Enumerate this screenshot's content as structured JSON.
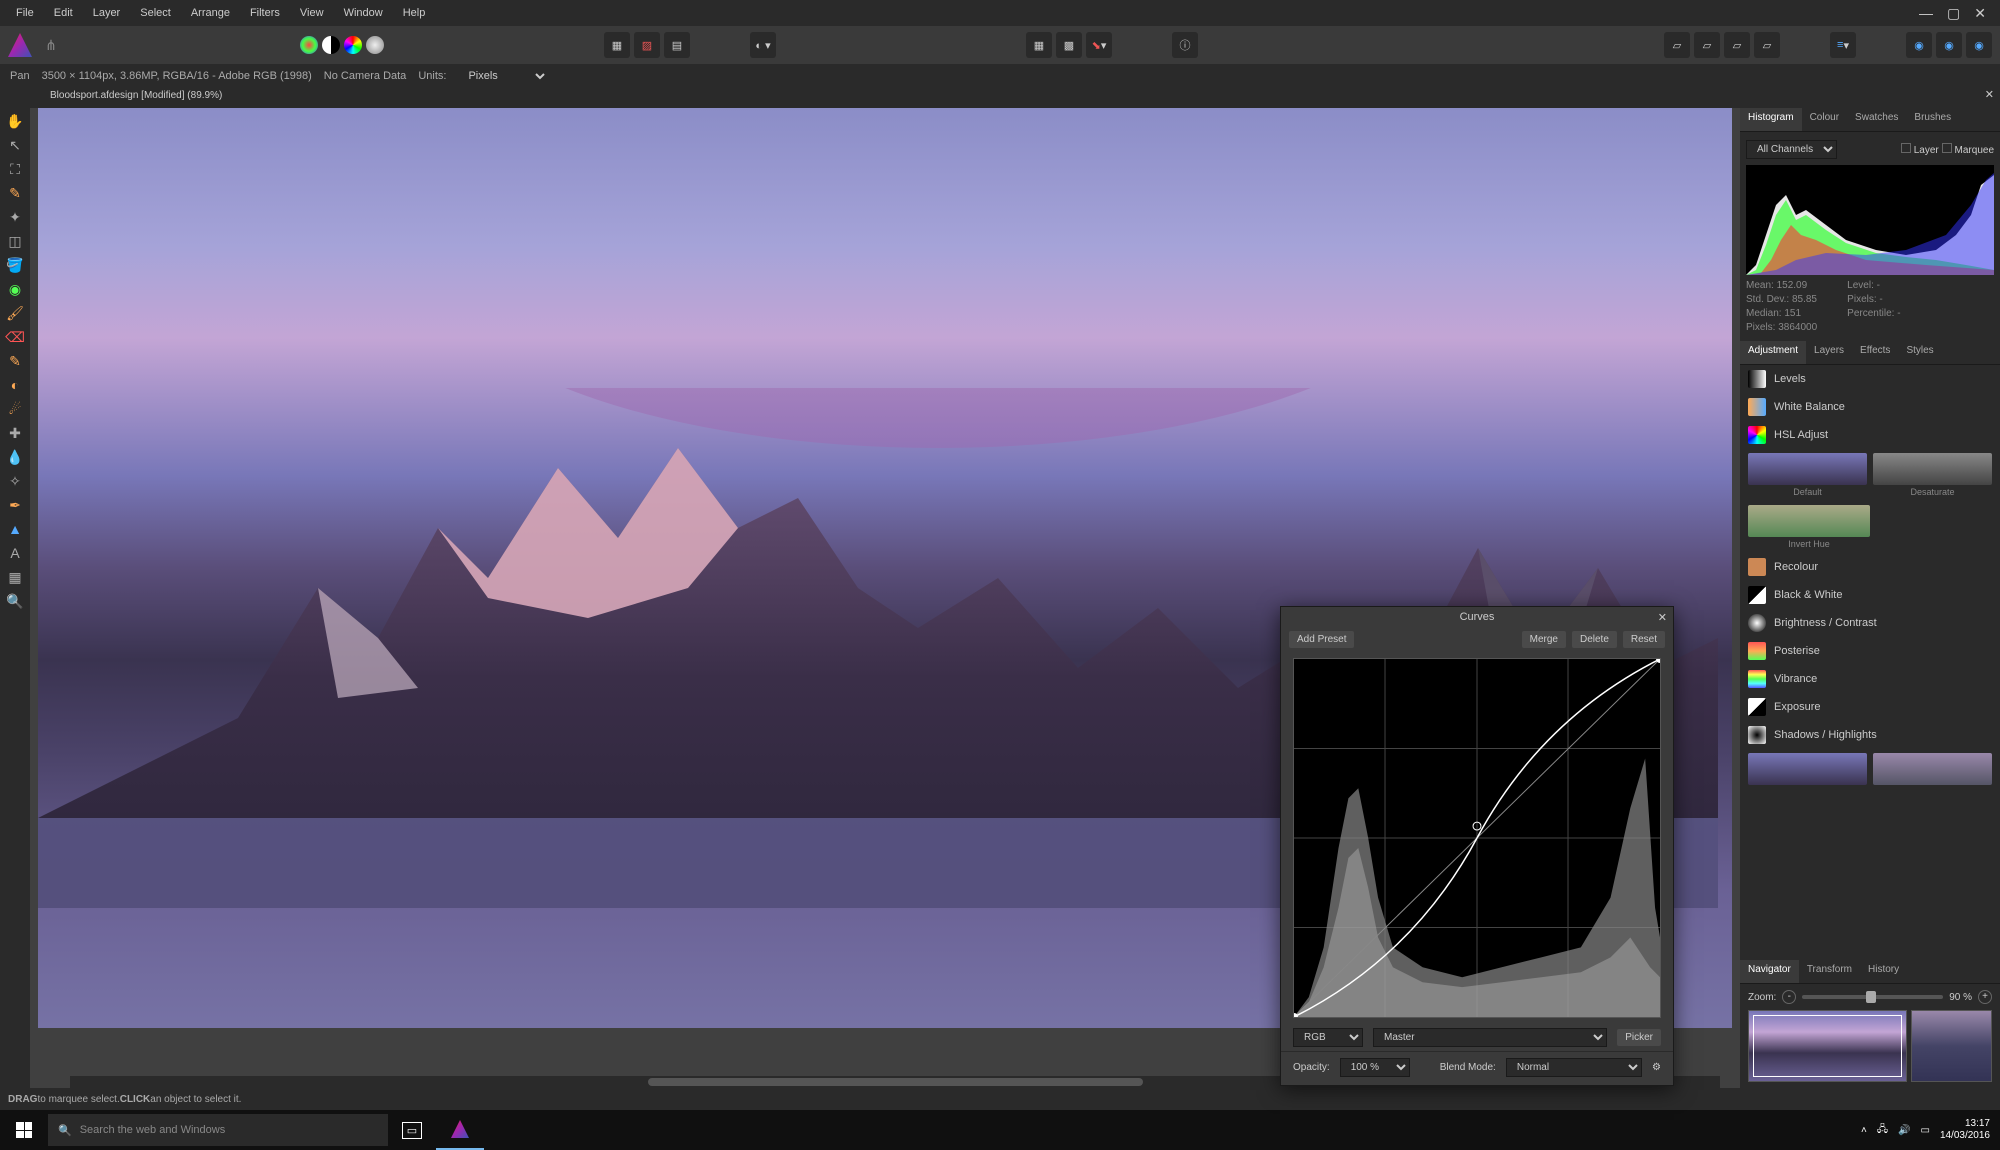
{
  "menu": {
    "file": "File",
    "edit": "Edit",
    "layer": "Layer",
    "select": "Select",
    "arrange": "Arrange",
    "filters": "Filters",
    "view": "View",
    "window": "Window",
    "help": "Help"
  },
  "context": {
    "tool": "Pan",
    "dims": "3500 × 1104px, 3.86MP, RGBA/16 - Adobe RGB (1998)",
    "camera": "No Camera Data",
    "units_label": "Units:",
    "units_value": "Pixels"
  },
  "doctab": {
    "title": "Bloodsport.afdesign [Modified] (89.9%)"
  },
  "histogram": {
    "tabs": [
      "Histogram",
      "Colour",
      "Swatches",
      "Brushes"
    ],
    "channel_select": "All Channels",
    "layer_cb": "Layer",
    "marquee_cb": "Marquee",
    "stats_left": {
      "mean": "Mean: 152.09",
      "stddev": "Std. Dev.: 85.85",
      "median": "Median: 151",
      "pixels": "Pixels: 3864000"
    },
    "stats_right": {
      "level": "Level: -",
      "pixels": "Pixels: -",
      "percentile": "Percentile: -"
    }
  },
  "adjustment": {
    "tabs": [
      "Adjustment",
      "Layers",
      "Effects",
      "Styles"
    ],
    "items": {
      "levels": "Levels",
      "whitebalance": "White Balance",
      "hsl": "HSL Adjust",
      "recolour": "Recolour",
      "bw": "Black & White",
      "brightness": "Brightness / Contrast",
      "posterise": "Posterise",
      "vibrance": "Vibrance",
      "exposure": "Exposure",
      "shadows": "Shadows / Highlights"
    },
    "presets": {
      "default": "Default",
      "desaturate": "Desaturate",
      "inverthue": "Invert Hue"
    }
  },
  "navigator": {
    "tabs": [
      "Navigator",
      "Transform",
      "History"
    ],
    "zoom_label": "Zoom:",
    "zoom_value": "90 %"
  },
  "curves": {
    "title": "Curves",
    "add_preset": "Add Preset",
    "merge": "Merge",
    "delete": "Delete",
    "reset": "Reset",
    "channel1": "RGB",
    "channel2": "Master",
    "picker": "Picker",
    "opacity_label": "Opacity:",
    "opacity_value": "100 %",
    "blend_label": "Blend Mode:",
    "blend_value": "Normal"
  },
  "status": {
    "drag": "DRAG",
    "drag_text": " to marquee select. ",
    "click": "CLICK",
    "click_text": " an object to select it."
  },
  "taskbar": {
    "search_placeholder": "Search the web and Windows",
    "time": "13:17",
    "date": "14/03/2016"
  }
}
